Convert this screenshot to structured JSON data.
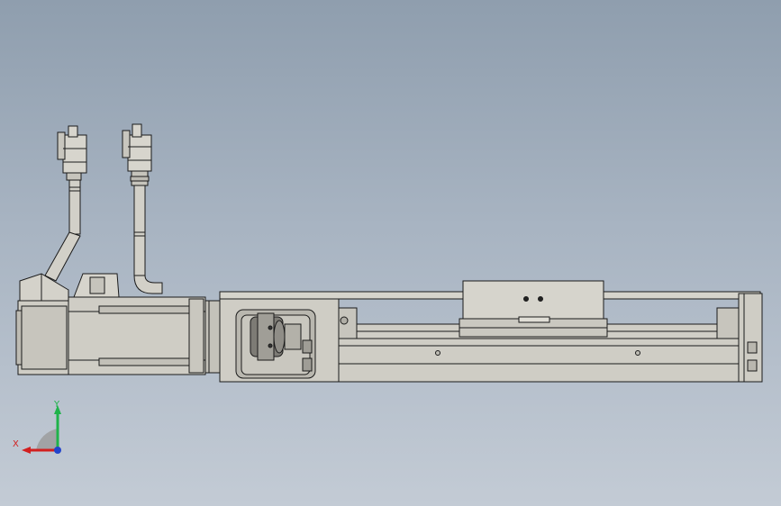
{
  "viewport": {
    "background_top": "#8f9eae",
    "background_bottom": "#c3cbd5",
    "model_fill": "#cfcdc5",
    "model_shade": "#b4b2aa",
    "edge_color": "#1a1a1a"
  },
  "triad": {
    "x_label": "X",
    "y_label": "Y",
    "x_color": "#d21f1f",
    "y_color": "#1fb34a",
    "z_color": "#2244cc"
  }
}
